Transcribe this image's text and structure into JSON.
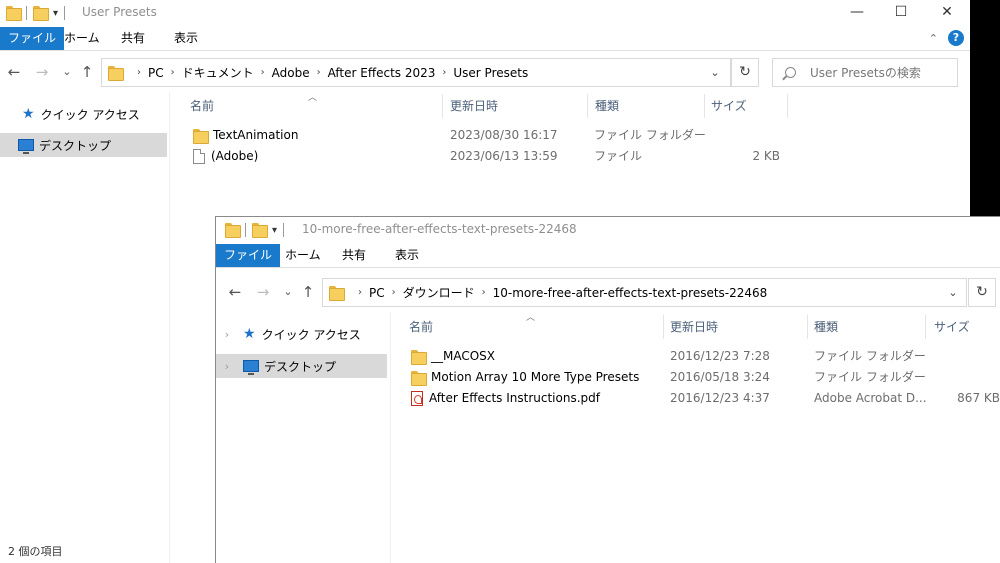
{
  "back_window": {
    "title": "User Presets",
    "ribbon_tabs": [
      "ファイル",
      "ホーム",
      "共有",
      "表示"
    ],
    "address_crumbs": [
      "PC",
      "ドキュメント",
      "Adobe",
      "After Effects 2023",
      "User Presets"
    ],
    "search_placeholder": "User Presetsの検索",
    "nav": {
      "quick_access": "クイック アクセス",
      "desktop": "デスクトップ"
    },
    "columns": [
      "名前",
      "更新日時",
      "種類",
      "サイズ"
    ],
    "files": [
      {
        "name": "TextAnimation",
        "modified": "2023/08/30 16:17",
        "type": "ファイル フォルダー",
        "size": "",
        "icon": "folder-icon"
      },
      {
        "name": "(Adobe)",
        "modified": "2023/06/13 13:59",
        "type": "ファイル",
        "size": "2 KB",
        "icon": "file-icon"
      }
    ],
    "status": "2 個の項目"
  },
  "front_window": {
    "title": "10-more-free-after-effects-text-presets-22468",
    "ribbon_tabs": [
      "ファイル",
      "ホーム",
      "共有",
      "表示"
    ],
    "address_crumbs": [
      "PC",
      "ダウンロード",
      "10-more-free-after-effects-text-presets-22468"
    ],
    "nav": {
      "quick_access": "クイック アクセス",
      "desktop": "デスクトップ"
    },
    "columns": [
      "名前",
      "更新日時",
      "種類",
      "サイズ"
    ],
    "files": [
      {
        "name": "__MACOSX",
        "modified": "2016/12/23 7:28",
        "type": "ファイル フォルダー",
        "size": "",
        "icon": "folder-icon"
      },
      {
        "name": "Motion Array 10 More Type Presets",
        "modified": "2016/05/18 3:24",
        "type": "ファイル フォルダー",
        "size": "",
        "icon": "folder-icon"
      },
      {
        "name": "After Effects Instructions.pdf",
        "modified": "2016/12/23 4:37",
        "type": "Adobe Acrobat D...",
        "size": "867 KB",
        "icon": "pdf-icon"
      }
    ]
  },
  "glyphs": {
    "minimize": "—",
    "maximize": "☐",
    "close": "✕",
    "back": "←",
    "forward": "→",
    "recent": "⌄",
    "up": "↑",
    "dropdown": "⌄",
    "refresh": "↻",
    "chevron": "›",
    "expander": "›",
    "star": "★",
    "sort_up": "︿",
    "help": "?",
    "ribbon_collapse": "⌃",
    "qa_dropdown": "▾"
  },
  "colors": {
    "accent": "#1979ca",
    "selection": "#d9d9d9",
    "header_text": "#4c607a",
    "meta_text": "#6d6d6d"
  }
}
